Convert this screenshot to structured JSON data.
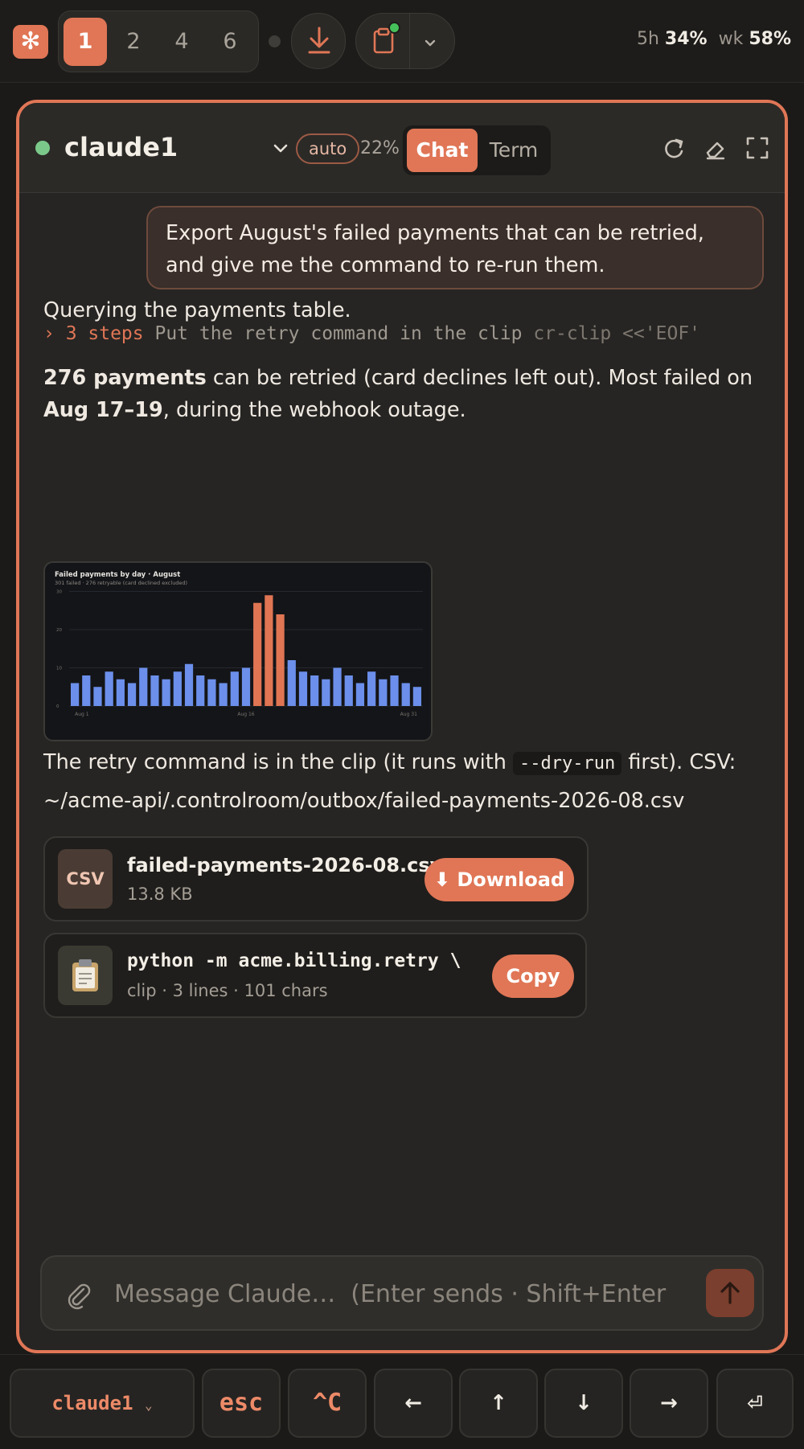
{
  "topbar": {
    "tabs": [
      "1",
      "2",
      "4",
      "6"
    ],
    "active_tab": "1",
    "usage": {
      "session_label": "5h",
      "session_value": "34%",
      "week_label": "wk",
      "week_value": "58%"
    }
  },
  "header": {
    "agent_name": "claude1",
    "mode": "auto",
    "context": "22%",
    "views": [
      "Chat",
      "Term"
    ],
    "active_view": "Chat"
  },
  "messages": {
    "user_text": "Export August's failed payments that can be retried, and give me the command to re-run them.",
    "line1": "Querying the payments table.",
    "steps": {
      "count": "› 3 steps",
      "text": "Put the retry command in the clip",
      "cmd": "cr-clip <<'EOF'"
    },
    "summary": {
      "strong1": "276 payments",
      "mid": " can be retried (card declines left out). Most failed on ",
      "strong2": "Aug 17–19",
      "end": ", during the webhook outage."
    },
    "retry": {
      "pre": "The retry command is in the clip (it runs with ",
      "code": "--dry-run",
      "post": " first). CSV:",
      "path": "~/acme-api/.controlroom/outbox/failed-payments-2026-08.csv"
    }
  },
  "chart_data": {
    "type": "bar",
    "title": "Failed payments by day · August",
    "subtitle": "301 failed · 276 retryable (card declined excluded)",
    "x_tick_labels": [
      "Aug 1",
      "Aug 16",
      "Aug 31"
    ],
    "y_ticks": [
      0,
      10,
      20,
      30
    ],
    "ylim": [
      0,
      32
    ],
    "categories": [
      "1",
      "2",
      "3",
      "4",
      "5",
      "6",
      "7",
      "8",
      "9",
      "10",
      "11",
      "12",
      "13",
      "14",
      "15",
      "16",
      "17",
      "18",
      "19",
      "20",
      "21",
      "22",
      "23",
      "24",
      "25",
      "26",
      "27",
      "28",
      "29",
      "30",
      "31"
    ],
    "values": [
      6,
      8,
      5,
      9,
      7,
      6,
      10,
      8,
      7,
      9,
      11,
      8,
      7,
      6,
      9,
      10,
      27,
      29,
      24,
      12,
      9,
      8,
      7,
      10,
      8,
      6,
      9,
      7,
      8,
      6,
      5
    ],
    "highlight": [
      "17",
      "18",
      "19"
    ],
    "colors": {
      "normal": "#6b8fea",
      "highlight": "#df7553"
    }
  },
  "attachments": {
    "csv": {
      "icon_text": "CSV",
      "name": "failed-payments-2026-08.csv",
      "size": "13.8 KB",
      "button": "⬇ Download"
    },
    "clip": {
      "icon": "clipboard-icon",
      "title": "python -m acme.billing.retry \\",
      "meta": "clip · 3 lines · 101 chars",
      "button": "Copy"
    }
  },
  "composer": {
    "placeholder": "Message Claude…  (Enter sends · Shift+Enter"
  },
  "keybar": {
    "session": "claude1",
    "session_caret": "⌄",
    "keys": [
      "esc",
      "^C",
      "←",
      "↑",
      "↓",
      "→",
      "⏎"
    ]
  },
  "colors": {
    "accent": "#e07656",
    "background": "#1b1a18",
    "panel": "#262523"
  }
}
